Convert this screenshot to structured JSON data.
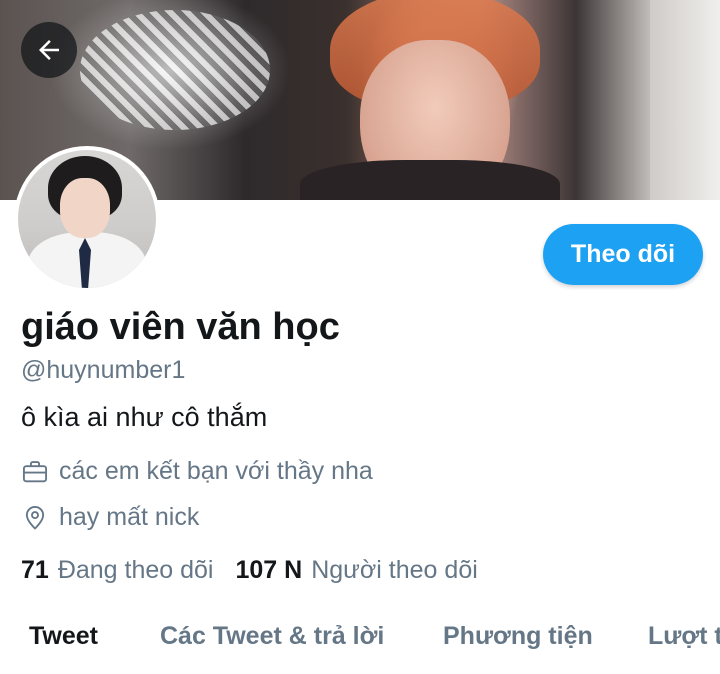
{
  "header": {
    "back_icon": "arrow-left-icon"
  },
  "profile": {
    "display_name": "giáo viên văn học",
    "handle": "@huynumber1",
    "bio": "ô kìa ai như cô thắm",
    "job": "các em kết bạn với thầy nha",
    "location": "hay mất nick",
    "follow_label": "Theo dõi",
    "following_count": "71",
    "following_label": "Đang theo dõi",
    "followers_count": "107 N",
    "followers_label": "Người theo dõi"
  },
  "tabs": [
    {
      "label": "Tweet",
      "active": true
    },
    {
      "label": "Các Tweet & trả lời",
      "active": false
    },
    {
      "label": "Phương tiện",
      "active": false
    },
    {
      "label": "Lượt thích",
      "active": false
    }
  ],
  "colors": {
    "accent": "#1da1f2",
    "secondary_text": "#657786",
    "primary_text": "#14171a"
  }
}
